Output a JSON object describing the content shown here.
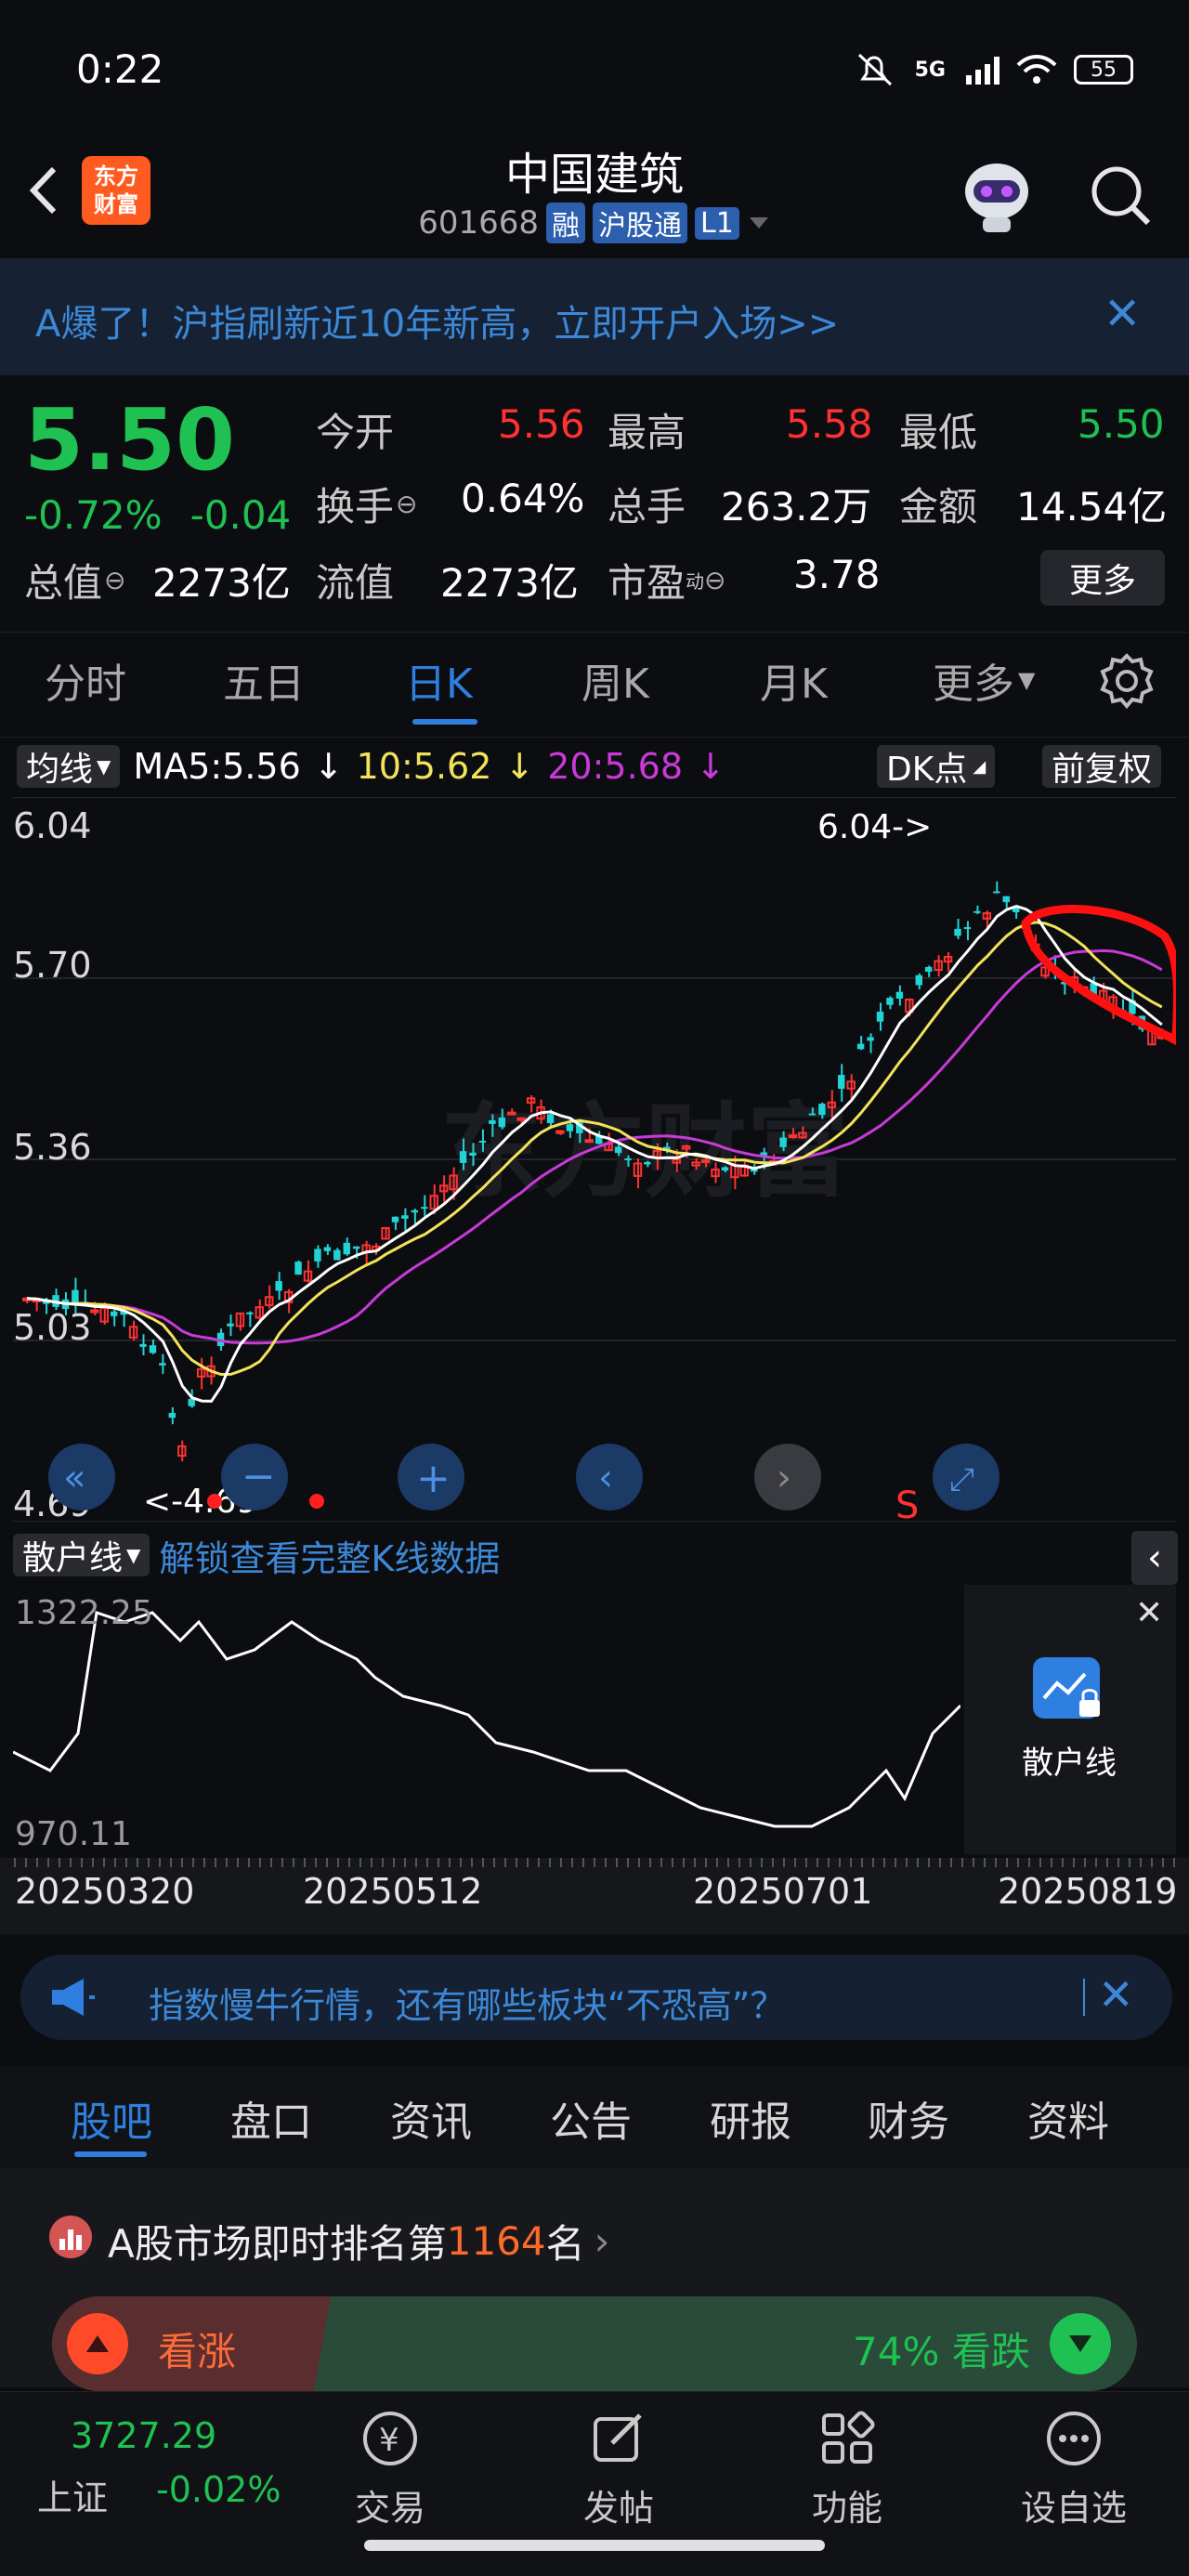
{
  "status": {
    "time": "0:22",
    "network": "5G",
    "battery": "55"
  },
  "header": {
    "logo_line1": "东方",
    "logo_line2": "财富",
    "title": "中国建筑",
    "code": "601668",
    "tag1": "融",
    "tag2": "沪股通",
    "tag3": "L1"
  },
  "banner": {
    "text": "A爆了！沪指刷新近10年新高，立即开户入场>>"
  },
  "quote": {
    "price": "5.50",
    "pct": "-0.72%",
    "chg": "-0.04",
    "open_label": "今开",
    "open": "5.56",
    "high_label": "最高",
    "high": "5.58",
    "low_label": "最低",
    "low": "5.50",
    "turnover_label": "换手",
    "turnover": "0.64%",
    "vol_label": "总手",
    "vol": "263.2万",
    "amount_label": "金额",
    "amount": "14.54亿",
    "mktcap_label": "总值",
    "mktcap": "2273亿",
    "float_label": "流值",
    "float": "2273亿",
    "pe_label": "市盈",
    "pe_sup": "动",
    "pe": "3.78",
    "more": "更多"
  },
  "tabs": [
    "分时",
    "五日",
    "日K",
    "周K",
    "月K",
    "更多"
  ],
  "ma": {
    "selector": "均线",
    "ma5": "MA5:5.56",
    "ma10": "10:5.62",
    "ma20": "20:5.68",
    "dk": "DK点",
    "adjust": "前复权"
  },
  "kline": {
    "y_ticks": [
      "6.04",
      "5.70",
      "5.36",
      "5.03",
      "4.69"
    ],
    "high_mark": "6.04->",
    "low_mark": "<-4.69",
    "sell_mark": "S",
    "watermark": "东方财富"
  },
  "indicator": {
    "selector": "散户线",
    "unlock": "解锁查看完整K线数据",
    "top": "1322.25",
    "bottom": "970.11",
    "side_label": "散户线"
  },
  "dates": [
    "20250320",
    "20250512",
    "20250701",
    "20250819"
  ],
  "notice": {
    "text": "指数慢牛行情，还有哪些板块“不恐高”？"
  },
  "section_tabs": [
    "股吧",
    "盘口",
    "资讯",
    "公告",
    "研报",
    "财务",
    "资料"
  ],
  "rank": {
    "prefix": "A股市场即时排名第",
    "number": "1164",
    "suffix": "名",
    "bull": "看涨",
    "bear": "74% 看跌"
  },
  "bottom": {
    "index_value": "3727.29",
    "index_name": "上证",
    "index_chg": "-0.02%",
    "nav": [
      "交易",
      "发帖",
      "功能",
      "设自选"
    ]
  },
  "colors": {
    "up": "#ff3232",
    "down": "#1fc152",
    "accent": "#2f7fe0",
    "ma5": "#ffffff",
    "ma10": "#f2e35a",
    "ma20": "#c93ad8"
  }
}
